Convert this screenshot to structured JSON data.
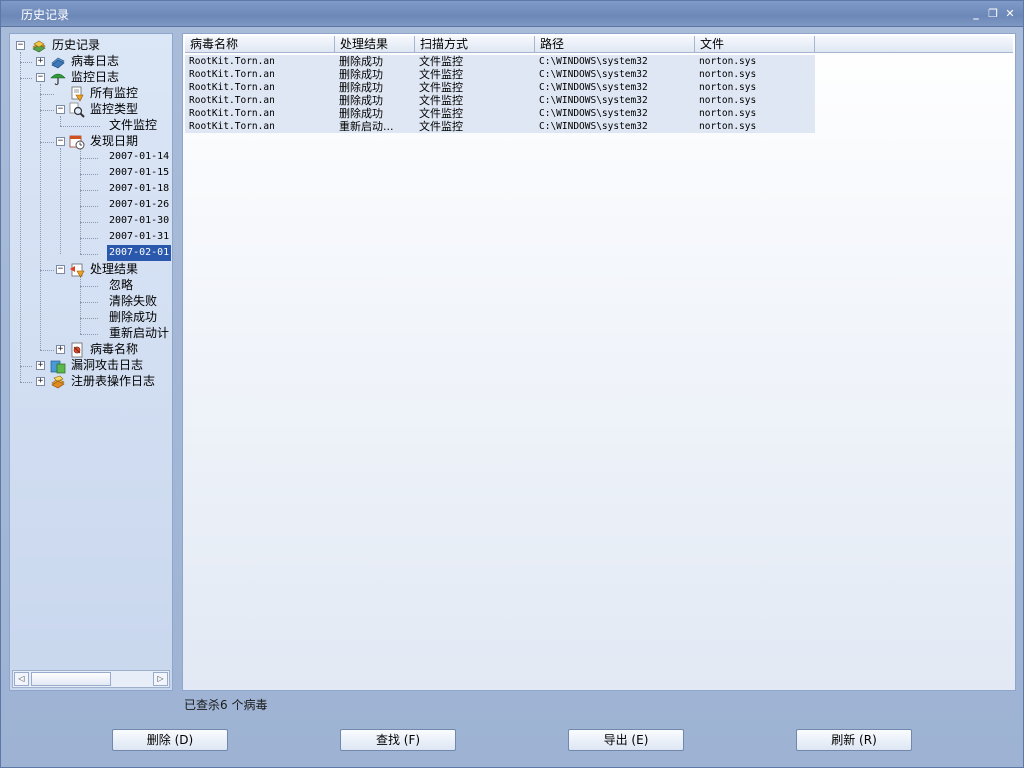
{
  "window": {
    "title": "历史记录",
    "minimize": "_",
    "maximize": "❐",
    "close": "✕"
  },
  "tree": {
    "root": "历史记录",
    "virus_log": "病毒日志",
    "monitor_log": "监控日志",
    "all_monitor": "所有监控",
    "monitor_type": "监控类型",
    "file_monitor": "文件监控",
    "found_date": "发现日期",
    "dates": [
      "2007-01-14",
      "2007-01-15",
      "2007-01-18",
      "2007-01-26",
      "2007-01-30",
      "2007-01-31",
      "2007-02-01"
    ],
    "selected_date_index": 6,
    "handle_result": "处理结果",
    "results": [
      "忽略",
      "清除失败",
      "删除成功",
      "重新启动计"
    ],
    "virus_name": "病毒名称",
    "exploit_log": "漏洞攻击日志",
    "registry_log": "注册表操作日志"
  },
  "table": {
    "columns": [
      "病毒名称",
      "处理结果",
      "扫描方式",
      "路径",
      "文件"
    ],
    "rows": [
      [
        "RootKit.Torn.an",
        "删除成功",
        "文件监控",
        "C:\\WINDOWS\\system32",
        "norton.sys"
      ],
      [
        "RootKit.Torn.an",
        "删除成功",
        "文件监控",
        "C:\\WINDOWS\\system32",
        "norton.sys"
      ],
      [
        "RootKit.Torn.an",
        "删除成功",
        "文件监控",
        "C:\\WINDOWS\\system32",
        "norton.sys"
      ],
      [
        "RootKit.Torn.an",
        "删除成功",
        "文件监控",
        "C:\\WINDOWS\\system32",
        "norton.sys"
      ],
      [
        "RootKit.Torn.an",
        "删除成功",
        "文件监控",
        "C:\\WINDOWS\\system32",
        "norton.sys"
      ],
      [
        "RootKit.Torn.an",
        "重新启动...",
        "文件监控",
        "C:\\WINDOWS\\system32",
        "norton.sys"
      ]
    ]
  },
  "status": "已查杀6 个病毒",
  "buttons": {
    "delete": "删除 (D)",
    "find": "查找 (F)",
    "export": "导出 (E)",
    "refresh": "刷新 (R)"
  }
}
